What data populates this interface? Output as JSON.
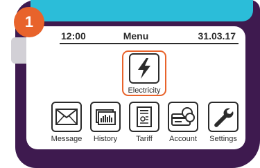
{
  "header": {
    "time": "12:00",
    "title": "Menu",
    "date": "31.03.17"
  },
  "badge": {
    "number": "1"
  },
  "selected": {
    "label": "Electricity",
    "icon": "lightning-bolt-icon"
  },
  "menu_items": [
    {
      "label": "Message",
      "icon": "envelope-icon"
    },
    {
      "label": "History",
      "icon": "bar-chart-icon"
    },
    {
      "label": "Tariff",
      "icon": "tariff-document-icon"
    },
    {
      "label": "Account",
      "icon": "card-coins-icon"
    },
    {
      "label": "Settings",
      "icon": "wrench-icon"
    }
  ],
  "colors": {
    "frame": "#3e1a4f",
    "top_bar": "#2bbdd9",
    "accent": "#e8632b",
    "ink": "#2b2b2b"
  }
}
